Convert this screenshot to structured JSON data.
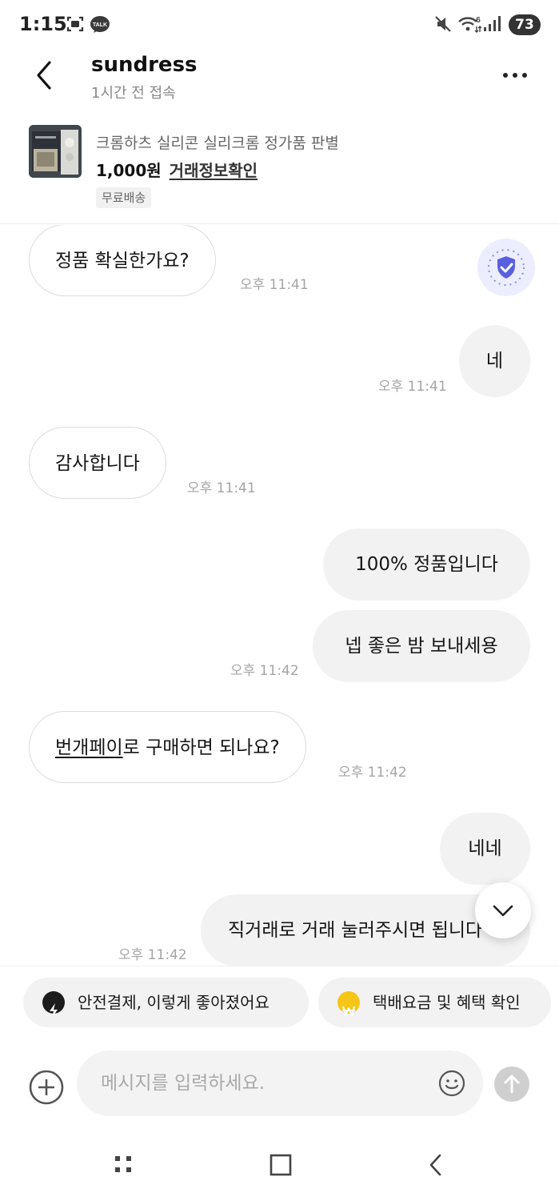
{
  "status_bar": {
    "time": "1:15",
    "talk_badge": "TALK",
    "battery": "73",
    "signal_tag": "6"
  },
  "header": {
    "title": "sundress",
    "subtitle": "1시간 전 접속"
  },
  "product": {
    "name": "크롬하츠 실리콘 실리크롬 정가품 판별",
    "price": "1,000원",
    "trade_info_link": "거래정보확인",
    "shipping_badge": "무료배송"
  },
  "messages": [
    {
      "side": "in",
      "text": "정품 확실한가요?",
      "time": "오후 11:41"
    },
    {
      "side": "out",
      "text": "네",
      "time": "오후 11:41"
    },
    {
      "side": "in",
      "text": "감사합니다",
      "time": "오후 11:41"
    },
    {
      "side": "out",
      "text": "100% 정품입니다",
      "time": ""
    },
    {
      "side": "out",
      "text": "넵 좋은 밤 보내세용",
      "time": "오후 11:42"
    },
    {
      "side": "in",
      "text_link": "번개페이",
      "text_rest": "로 구매하면 되나요?",
      "time": "오후 11:42"
    },
    {
      "side": "out",
      "text": "네네",
      "time": ""
    },
    {
      "side": "out",
      "text": "직거래로 거래 눌러주시면 됩니다",
      "time": "오후 11:42"
    }
  ],
  "chips": [
    {
      "label": "안전결제, 이렇게 좋아졌어요",
      "icon": "lightning-icon"
    },
    {
      "label": "택배요금 및 혜택 확인",
      "icon": "won-coin-icon"
    }
  ],
  "composer": {
    "placeholder": "메시지를 입력하세요."
  },
  "colors": {
    "accent_shield": "#5a5fe0",
    "won_coin": "#f5c518",
    "bubble_out_bg": "#f2f2f2",
    "time_text": "#a5a5a5"
  }
}
